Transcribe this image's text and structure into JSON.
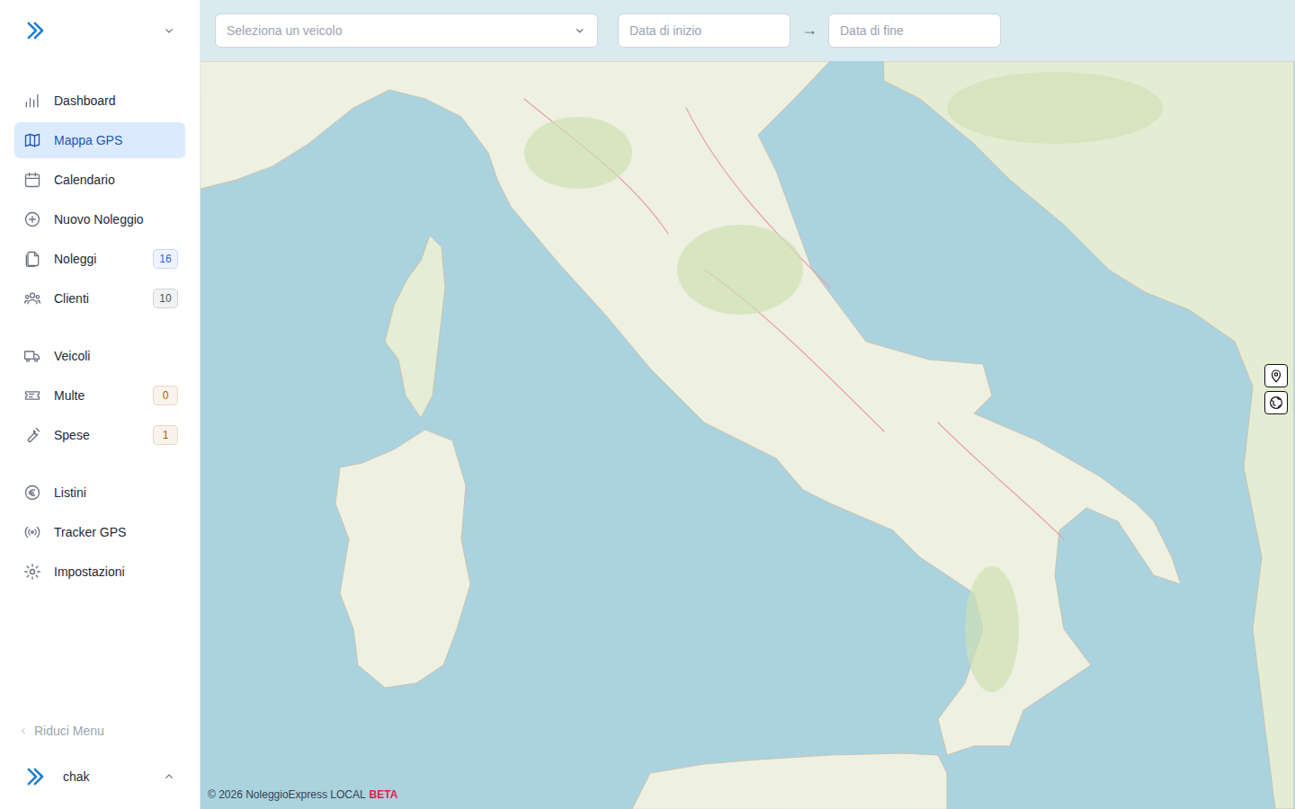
{
  "sidebar": {
    "groups": [
      [
        {
          "label": "Dashboard",
          "selected": false
        },
        {
          "label": "Mappa GPS",
          "selected": true
        },
        {
          "label": "Calendario",
          "selected": false
        },
        {
          "label": "Nuovo Noleggio",
          "selected": false
        },
        {
          "label": "Noleggi",
          "selected": false,
          "badge": {
            "text": "16",
            "color": "#2563eb"
          }
        },
        {
          "label": "Clienti",
          "selected": false,
          "badge": {
            "text": "10",
            "color": "#4b5563"
          }
        }
      ],
      [
        {
          "label": "Veicoli",
          "selected": false
        },
        {
          "label": "Multe",
          "selected": false,
          "badge": {
            "text": "0",
            "color": "#a16207"
          }
        },
        {
          "label": "Spese",
          "selected": false,
          "badge": {
            "text": "1",
            "color": "#a16207"
          }
        }
      ],
      [
        {
          "label": "Listini",
          "selected": false
        },
        {
          "label": "Tracker GPS",
          "selected": false
        },
        {
          "label": "Impostazioni",
          "selected": false
        }
      ]
    ],
    "collapse_label": "Riduci Menu",
    "user": {
      "name": "chak"
    }
  },
  "toolbar": {
    "vehicle_select": {
      "placeholder": "Seleziona un veicolo"
    },
    "start_date": {
      "placeholder": "Data di inizio"
    },
    "arrow": "→",
    "end_date": {
      "placeholder": "Data di fine"
    }
  },
  "footer": {
    "copyright": "© 2026 NoleggioExpress LOCAL",
    "tag": "BETA"
  }
}
